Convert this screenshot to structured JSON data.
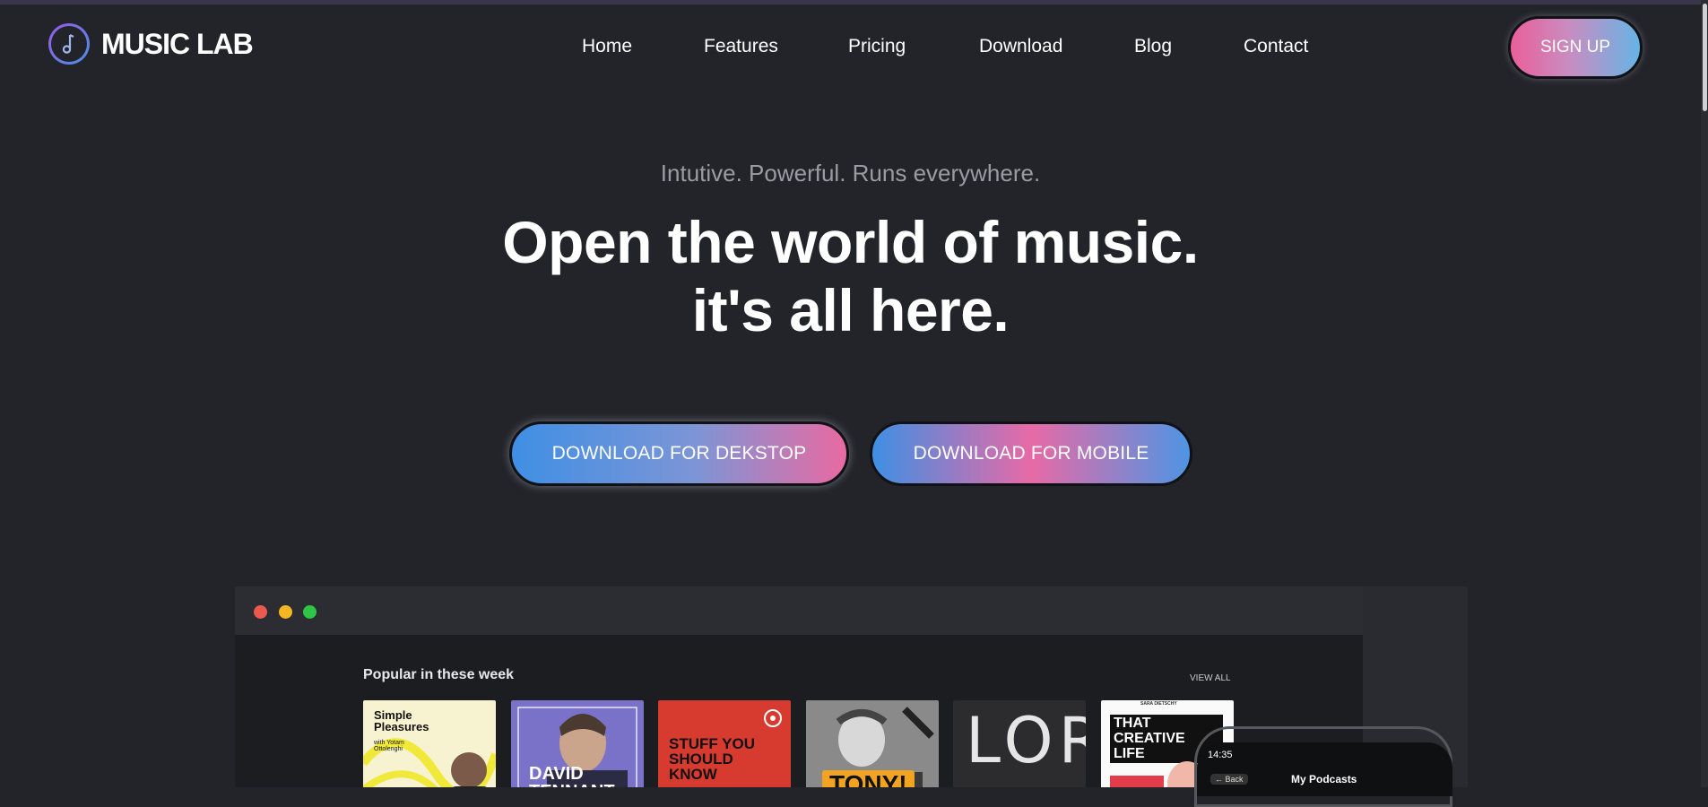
{
  "brand": {
    "name": "MUSIC LAB",
    "icon": "music-note-icon",
    "accent": "#9b59e8"
  },
  "nav": [
    {
      "label": "Home"
    },
    {
      "label": "Features"
    },
    {
      "label": "Pricing"
    },
    {
      "label": "Download"
    },
    {
      "label": "Blog"
    },
    {
      "label": "Contact"
    }
  ],
  "signup_label": "SIGN UP",
  "hero": {
    "tagline": "Intutive. Powerful. Runs everywhere.",
    "headline_line1": "Open the world of music.",
    "headline_line2": "it's all here."
  },
  "buttons": {
    "desktop": "DOWNLOAD FOR DEKSTOP",
    "mobile": "DOWNLOAD FOR MOBILE"
  },
  "preview": {
    "section_title": "Popular in these week",
    "view_all": "VIEW ALL",
    "cards": [
      {
        "title": "Simple Pleasures",
        "subtitle": "with Yotam Ottolenghi"
      },
      {
        "title": "DAVID TENNANT"
      },
      {
        "title": "STUFF YOU SHOULD KNOW"
      },
      {
        "title": "TONY!"
      },
      {
        "title": "LORE"
      },
      {
        "title": "THAT CREATIVE LIFE",
        "author": "SARA DIETSCHY"
      }
    ],
    "phone": {
      "time": "14:35",
      "back": "Back",
      "title": "My Podcasts"
    }
  },
  "colors": {
    "background": "#22242a",
    "pink": "#ea5f9a",
    "blue": "#3f8fe4"
  }
}
